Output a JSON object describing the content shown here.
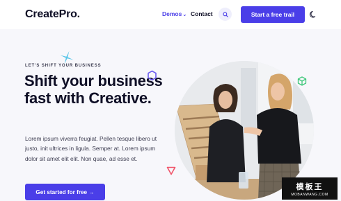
{
  "brand": {
    "logo": "CreatePro."
  },
  "nav": {
    "demos": "Demos",
    "contact": "Contact",
    "cta": "Start a free trail"
  },
  "hero": {
    "eyebrow": "LET'S SHIFT YOUR BUSINESS",
    "headline": "Shift your business fast with Creative.",
    "paragraph": "Lorem ipsum viverra feugiat. Pellen tesque libero ut justo, init ultrices in ligula. Semper at. Lorem ipsum dolor sit amet elit elit. Non quae, ad esse et.",
    "cta": "Get started for free →"
  },
  "watermark": {
    "top": "模板王",
    "bottom": "MOBANWANG.COM"
  },
  "icons": {
    "search": "search-icon",
    "moon": "moon-icon",
    "chevron": "chevron-down-icon",
    "sparkle": "sparkle-icon",
    "hexagon": "hexagon-icon",
    "triangle": "triangle-icon",
    "cube": "cube-icon"
  },
  "colors": {
    "accent": "#4a3ee8",
    "text": "#0f0f26",
    "sparkle": "#5bc6e8",
    "hexagon": "#6b5cf0",
    "triangle": "#f0556a",
    "cube": "#3fc77a"
  }
}
